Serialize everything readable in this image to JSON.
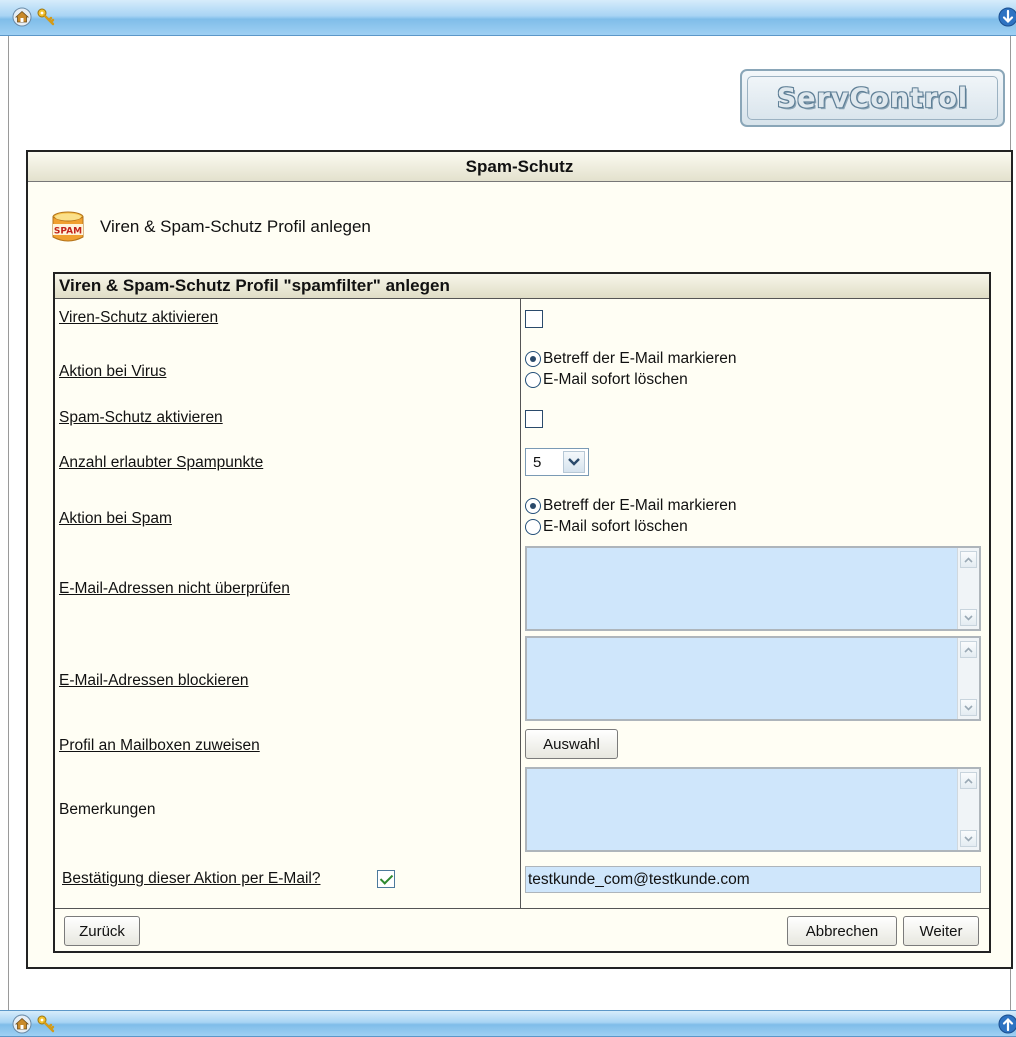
{
  "app": {
    "logo_text": "ServControl",
    "panel_title": "Spam-Schutz",
    "subheader": "Viren & Spam-Schutz Profil anlegen",
    "spam_icon_text": "SPAM"
  },
  "form": {
    "title": "Viren & Spam-Schutz Profil \"spamfilter\" anlegen",
    "virus_protection": {
      "label": "Viren-Schutz aktivieren",
      "checked": false
    },
    "virus_action": {
      "label": "Aktion bei Virus",
      "options": [
        "Betreff der E-Mail markieren",
        "E-Mail sofort löschen"
      ],
      "selected": 0
    },
    "spam_protection": {
      "label": "Spam-Schutz aktivieren",
      "checked": false
    },
    "spam_points": {
      "label": "Anzahl erlaubter Spampunkte",
      "value": "5"
    },
    "spam_action": {
      "label": "Aktion bei Spam",
      "options": [
        "Betreff der E-Mail markieren",
        "E-Mail sofort löschen"
      ],
      "selected": 0
    },
    "whitelist": {
      "label": "E-Mail-Adressen nicht überprüfen",
      "value": ""
    },
    "blacklist": {
      "label": "E-Mail-Adressen blockieren",
      "value": ""
    },
    "assign": {
      "label": "Profil an Mailboxen zuweisen",
      "button": "Auswahl"
    },
    "remarks": {
      "label": "Bemerkungen",
      "value": ""
    },
    "confirmation": {
      "label": "Bestätigung dieser Aktion per E-Mail?",
      "checked": true,
      "email": "testkunde_com@testkunde.com"
    }
  },
  "buttons": {
    "back": "Zurück",
    "cancel": "Abbrechen",
    "next": "Weiter"
  },
  "colors": {
    "bar_blue": "#9fd0f3",
    "input_bg": "#cfe6fb",
    "panel_bg": "#fffef4",
    "check_green": "#2f8a2f"
  }
}
